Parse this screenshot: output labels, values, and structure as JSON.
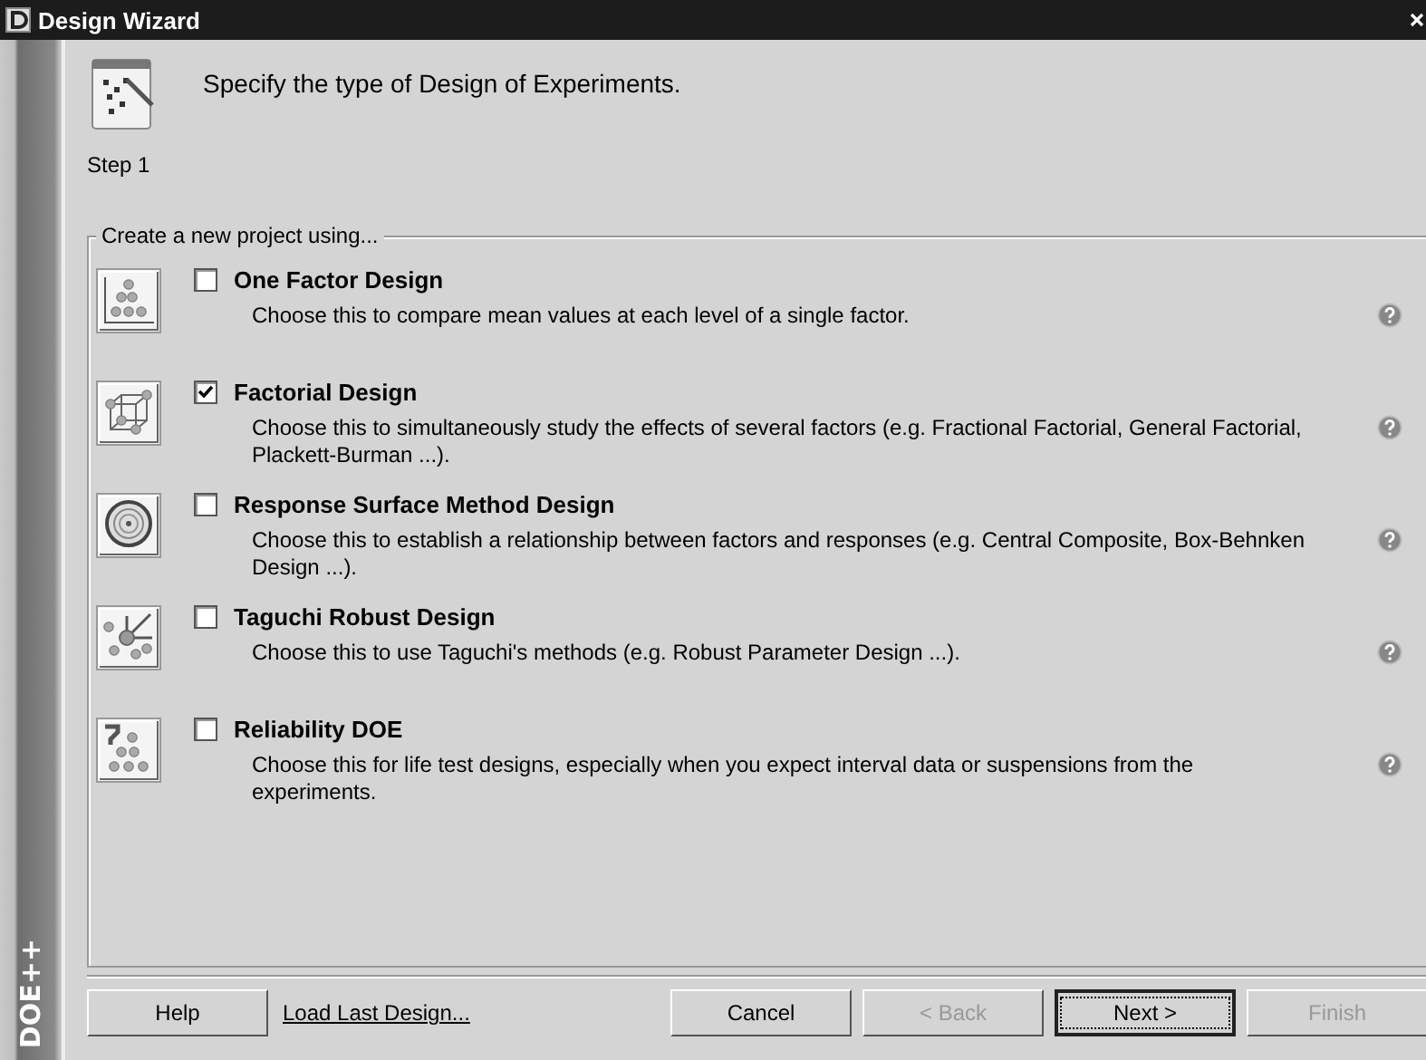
{
  "window": {
    "title": "Design Wizard",
    "side_label": "DOE++"
  },
  "header": {
    "instruction": "Specify the type of Design of Experiments.",
    "step": "Step 1"
  },
  "group": {
    "legend": "Create a new project using...",
    "options": [
      {
        "kind": "one-factor",
        "title": "One Factor Design",
        "description": "Choose this to compare mean values at each level of a single factor.",
        "checked": false
      },
      {
        "kind": "factorial",
        "title": "Factorial Design",
        "description": "Choose this to simultaneously study the effects of several factors (e.g. Fractional Factorial, General Factorial, Plackett-Burman ...).",
        "checked": true
      },
      {
        "kind": "response-surface",
        "title": "Response Surface Method Design",
        "description": "Choose this to establish a relationship between factors and responses (e.g. Central Composite, Box-Behnken Design ...).",
        "checked": false
      },
      {
        "kind": "taguchi",
        "title": "Taguchi Robust Design",
        "description": "Choose this to use Taguchi's methods (e.g. Robust Parameter Design ...).",
        "checked": false
      },
      {
        "kind": "reliability",
        "title": "Reliability DOE",
        "description": "Choose this for life test designs, especially when you expect interval data or suspensions from the experiments.",
        "checked": false
      }
    ]
  },
  "footer": {
    "help": "Help",
    "load_link": "Load Last Design...",
    "buttons": [
      {
        "label": "Cancel",
        "disabled": false,
        "default": false
      },
      {
        "label": "< Back",
        "disabled": true,
        "default": false
      },
      {
        "label": "Next >",
        "disabled": false,
        "default": true
      },
      {
        "label": "Finish",
        "disabled": true,
        "default": false
      }
    ]
  }
}
